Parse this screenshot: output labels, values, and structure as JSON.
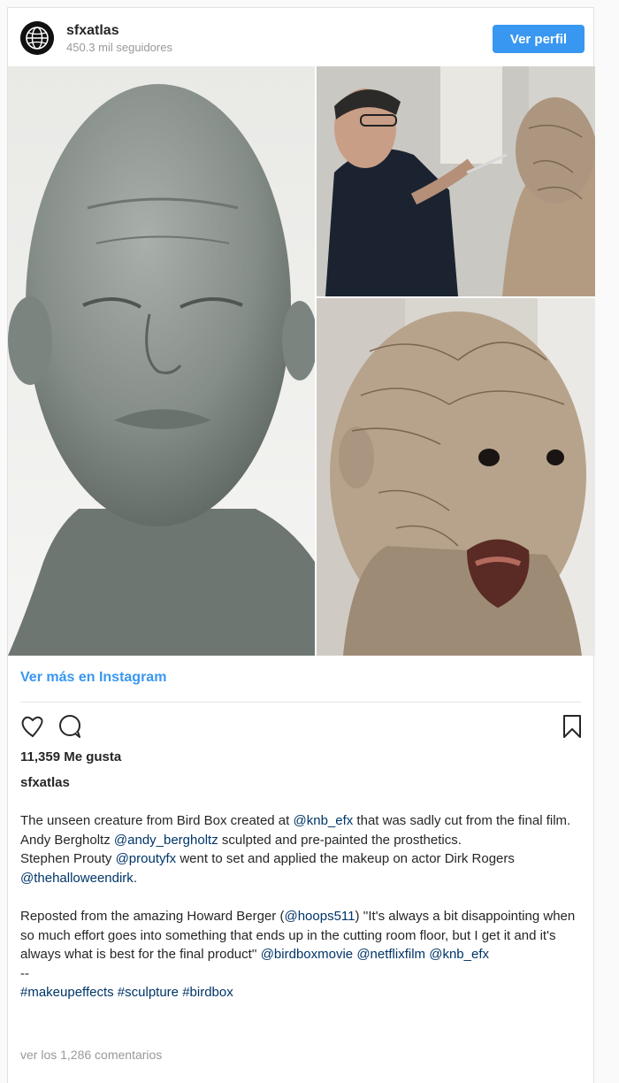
{
  "header": {
    "username": "sfxatlas",
    "followers": "450.3 mil seguidores",
    "profile_button": "Ver perfil"
  },
  "links": {
    "more_instagram": "Ver más en Instagram"
  },
  "post": {
    "likes": "11,359 Me gusta",
    "owner": "sfxatlas",
    "caption": {
      "p1_a": "The unseen creature from Bird Box created at ",
      "p1_m1": "@knb_efx",
      "p1_b": " that was sadly cut from the final film.",
      "p2_a": "Andy Bergholtz ",
      "p2_m1": "@andy_bergholtz",
      "p2_b": " sculpted and pre-painted the prosthetics.",
      "p3_a": "Stephen Prouty ",
      "p3_m1": "@proutyfx",
      "p3_b": " went to set and applied the makeup on actor Dirk Rogers ",
      "p3_m2": "@thehalloweendirk",
      "p3_c": ".",
      "p4_a": "Reposted from the amazing Howard Berger (",
      "p4_m1": "@hoops511",
      "p4_b": ") ''It's always a bit disappointing when so much effort goes into something that ends up in the cutting room floor, but I get it and it's always what is best for the final product'' ",
      "p4_m2": "@birdboxmovie",
      "p4_m3": "@netflixfilm",
      "p4_m4": "@knb_efx",
      "p5": "--",
      "tag1": "#makeupeffects",
      "tag2": "#sculpture",
      "tag3": "#birdbox"
    },
    "comments": "ver los 1,286 comentarios"
  },
  "icons": [
    "globe-avatar-icon",
    "heart-icon",
    "comment-icon",
    "bookmark-icon"
  ]
}
